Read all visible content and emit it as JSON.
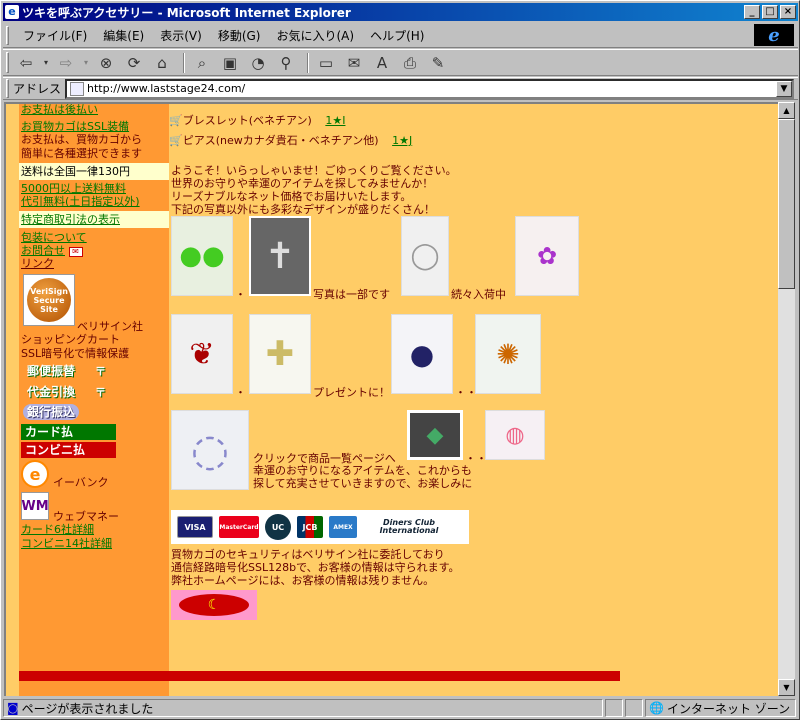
{
  "window": {
    "title": "ツキを呼ぶアクセサリー - Microsoft Internet Explorer",
    "min": "_",
    "max": "□",
    "close": "×"
  },
  "menu": [
    "ファイル(F)",
    "編集(E)",
    "表示(V)",
    "移動(G)",
    "お気に入り(A)",
    "ヘルプ(H)"
  ],
  "toolbar": {
    "icons": [
      "back-icon",
      "forward-icon",
      "stop-icon",
      "refresh-icon",
      "home-icon",
      "search-icon",
      "favorites-icon",
      "history-icon",
      "channels-icon",
      "fullscreen-icon",
      "mail-icon",
      "font-icon",
      "print-icon",
      "edit-icon"
    ]
  },
  "address": {
    "label": "アドレス",
    "url": "http://www.laststage24.com/"
  },
  "sidebar": {
    "top_link": "お支払は後払い",
    "cart_ssl": "お買物カゴはSSL装備",
    "pay_text1": "お支払は、買物カゴから",
    "pay_text2": "簡単に各種選択できます",
    "shipping_note": "送料は全国一律130円",
    "free_ship": "5000円以上送料無料",
    "cod_free": "代引無料(土日指定以外)",
    "law_link": "特定商取引法の表示",
    "wrap_link": "包装について",
    "contact_link": "お問合せ",
    "links_link": "リンク",
    "verisign_seal1": "VeriSign",
    "verisign_seal2": "Secure",
    "verisign_seal3": "Site",
    "verisign_caption1": "ベリサイン社",
    "verisign_caption2": "ショッピングカート",
    "verisign_caption3": "SSL暗号化で情報保護",
    "pay_postal": "郵便振替",
    "pay_cod": "代金引換",
    "pay_bank": "銀行振込",
    "pay_card": "カード払",
    "pay_conv": "コンビニ払",
    "ebank": "イーバンク",
    "webmoney": "ウェブマネー",
    "card_detail": "カード6社詳細",
    "conv_detail": "コンビニ14社詳細"
  },
  "main": {
    "item1": "ブレスレット(ベネチアン)",
    "item1_link": "1★I",
    "item2": "ピアス(newカナダ貴石・ベネチアン他)",
    "item2_link": "1★J",
    "welcome1": "ようこそ！いらっしゃいませ！ごゆっくりご覧ください。",
    "welcome2": "世界のお守りや幸運のアイテムを探してみませんか！",
    "welcome3": "リーズナブルなネット価格でお届けいたします。",
    "welcome4": "下記の写真以外にも多彩なデザインが盛りだくさん！",
    "cap_part": "写真は一部です",
    "cap_more": "続々入荷中",
    "cap_present": "プレゼントに！",
    "dots": "・・",
    "dots3": "・・・",
    "click_text": "クリックで商品一覧ページへ",
    "closing1": "幸運のお守りになるアイテムを、これからも",
    "closing2": "探して充実させていきますので、お楽しみに",
    "security1": "買物カゴのセキュリティはベリサイン社に委託しており",
    "security2": "通信経路暗号化SSL128bで、お客様の情報は守られます。",
    "security3": "弊社ホームページには、お客様の情報は残りません。",
    "cards": [
      "VISA",
      "MasterCard",
      "UC",
      "JCB",
      "AMEX",
      "Diners Club International"
    ]
  },
  "status": {
    "text": "ページが表示されました",
    "zone": "インターネット ゾーン"
  },
  "colors": {
    "page_bg": "#ffcc66",
    "sidebar_bg": "#ff9933",
    "link": "#007700",
    "text": "#660000",
    "accent": "#cc0000"
  }
}
